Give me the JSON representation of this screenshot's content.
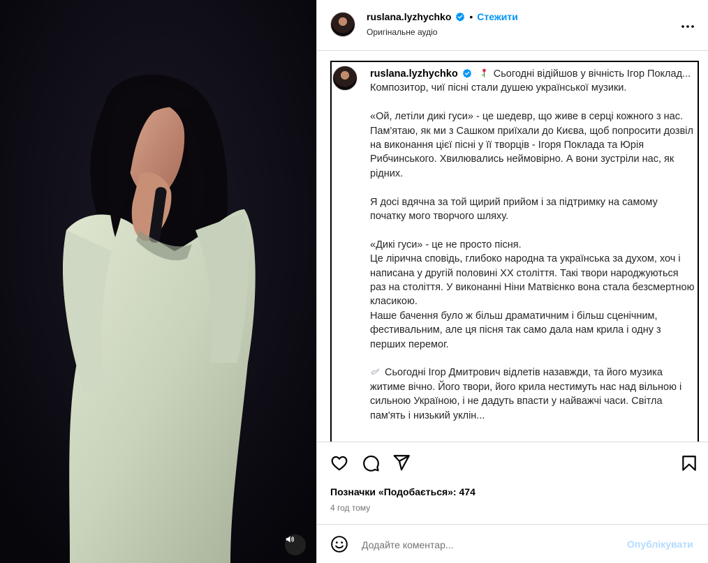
{
  "colors": {
    "accent": "#0095f6",
    "publish_disabled": "#b3dbff",
    "secondary_text": "#737373",
    "divider": "#dbdbdb"
  },
  "media": {
    "sound_icon": "speaker-icon"
  },
  "header": {
    "username": "ruslana.lyzhychko",
    "separator": "•",
    "follow_label": "Стежити",
    "audio_label": "Оригінальне аудіо",
    "more_icon": "more-horizontal-icon"
  },
  "caption": {
    "username": "ruslana.lyzhychko",
    "emoji_first": "flower-emoji-icon",
    "first_line": "Сьогодні відійшов у вічність Ігор Поклад...",
    "lines": [
      "Композитор, чиї пісні стали душею української музики.",
      "",
      "«Ой, летіли дикі гуси» - це шедевр, що живе в серці кожного з нас. Пам'ятаю, як ми з Сашком приїхали до Києва, щоб попросити дозвіл на виконання цієї пісні у її творців - Ігоря Поклада та Юрія Рибчинського. Хвилювались неймовірно. А вони зустріли нас, як рідних.",
      "",
      "Я досі вдячна за той щирий прийом і за підтримку на самому початку мого творчого шляху.",
      "",
      "«Дикі гуси» - це не просто пісня.",
      "Це лірична сповідь, глибоко народна та українська за духом, хоч і написана у другій половині ХХ століття. Такі твори народжуються раз на століття. У виконанні Ніни Матвієнко вона стала безсмертною класикою.",
      "Наше бачення було ж більш драматичним і більш сценічним, фестивальним, але ця пісня так само дала нам крила і одну з перших перемог.",
      ""
    ],
    "emoji_last": "dove-emoji-icon",
    "last_line": "Сьогодні Ігор Дмитрович відлетів назавжди, та його музика житиме вічно. Його твори, його крила нестимуть нас над вільною і сильною Україною, і не дадуть впасти у найважчі часи. Світла пам'ять і низький уклін..."
  },
  "actions": {
    "like_icon": "heart-icon",
    "comment_icon": "comment-icon",
    "share_icon": "send-icon",
    "save_icon": "bookmark-icon"
  },
  "likes": {
    "label": "Позначки «Подобається»:",
    "count": "474"
  },
  "timestamp": "4 год тому",
  "comment": {
    "emoji_icon": "smiley-icon",
    "placeholder": "Додайте коментар...",
    "publish_label": "Опублікувати"
  }
}
